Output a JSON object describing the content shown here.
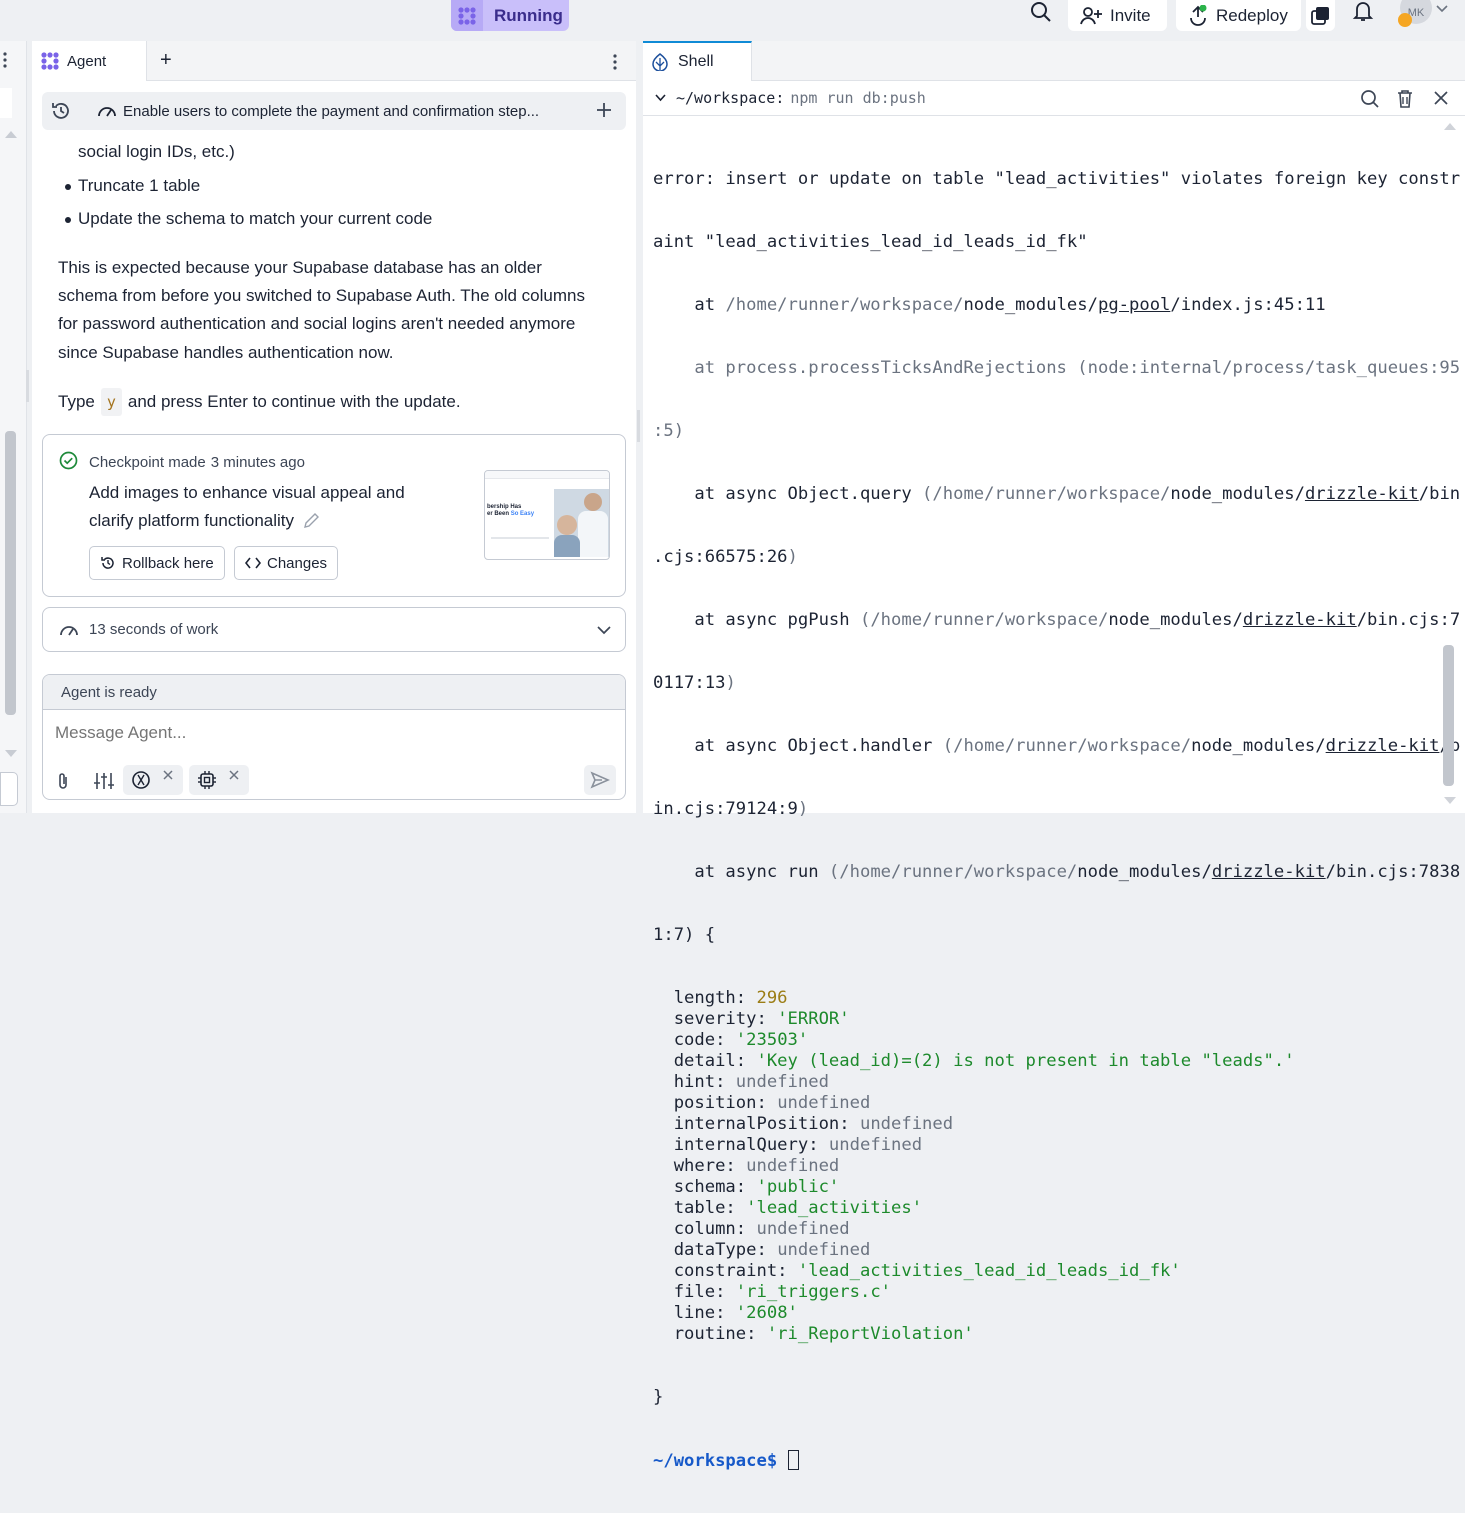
{
  "topbar": {
    "status_label": "Running",
    "invite_label": "Invite",
    "redeploy_label": "Redeploy",
    "avatar_initials": "MK"
  },
  "agent": {
    "tab_label": "Agent",
    "add_tab": "+",
    "task_title": "Enable users to complete the payment and confirmation step...",
    "body": {
      "line_partial": "social login IDs, etc.)",
      "bullets": [
        "Truncate 1 table",
        "Update the schema to match your current code"
      ],
      "paragraph_lines": [
        "This is expected because your Supabase database has an older",
        "schema from before you switched to Supabase Auth. The old columns",
        "for password authentication and social logins aren't needed anymore",
        "since Supabase handles authentication now."
      ],
      "type_prefix": "Type",
      "type_key": "y",
      "type_suffix": "and press Enter to continue with the update."
    },
    "checkpoint": {
      "made_label": "Checkpoint made",
      "time_ago": "3 minutes ago",
      "description_line1": "Add images to enhance visual appeal and",
      "description_line2": "clarify platform functionality",
      "rollback_label": "Rollback here",
      "changes_label": "Changes",
      "thumb_heading_1": "bership Has",
      "thumb_heading_2": "er Been",
      "thumb_heading_accent": "So Easy"
    },
    "work_summary": "13 seconds of work",
    "composer": {
      "status": "Agent is ready",
      "placeholder": "Message Agent..."
    }
  },
  "shell": {
    "tab_label": "Shell",
    "cwd": "~/workspace:",
    "command": "npm run db:push",
    "prompt": "~/workspace$",
    "output": {
      "l1": "error: insert or update on table \"lead_activities\" violates foreign key constr",
      "l2": "aint \"lead_activities_lead_id_leads_id_fk\"",
      "l3_at": "    at ",
      "l3_dim": "/home/runner/workspace/",
      "l3_a": "node_modules/",
      "l3_u": "pg-pool",
      "l3_b": "/index.js:45:11",
      "l4": "    at process.processTicksAndRejections (node:internal/process/task_queues:95",
      "l5": ":5)",
      "l6_a": "    at async Object.query ",
      "l6_dim": "(/home/runner/workspace/",
      "l6_b": "node_modules/",
      "l6_u": "drizzle-kit",
      "l6_c": "/bin",
      "l7": ".cjs:66575:26",
      "l7_dim": ")",
      "l8_a": "    at async pgPush ",
      "l8_dim": "(/home/runner/workspace/",
      "l8_b": "node_modules/",
      "l8_u": "drizzle-kit",
      "l8_c": "/bin.cjs:7",
      "l9": "0117:13",
      "l9_dim": ")",
      "l10_a": "    at async Object.handler ",
      "l10_dim": "(/home/runner/workspace/",
      "l10_b": "node_modules/",
      "l10_u": "drizzle-kit",
      "l10_c": "/b",
      "l11": "in.cjs:79124:9",
      "l11_dim": ")",
      "l12_a": "    at async run ",
      "l12_dim": "(/home/runner/workspace/",
      "l12_b": "node_modules/",
      "l12_u": "drizzle-kit",
      "l12_c": "/bin.cjs:7838",
      "l13": "1:7) {",
      "fields": [
        {
          "key": "  length: ",
          "val": "296",
          "cls": "t-num"
        },
        {
          "key": "  severity: ",
          "val": "'ERROR'",
          "cls": "t-str"
        },
        {
          "key": "  code: ",
          "val": "'23503'",
          "cls": "t-str"
        },
        {
          "key": "  detail: ",
          "val": "'Key (lead_id)=(2) is not present in table \"leads\".'",
          "cls": "t-str"
        },
        {
          "key": "  hint: ",
          "val": "undefined",
          "cls": "t-dim"
        },
        {
          "key": "  position: ",
          "val": "undefined",
          "cls": "t-dim"
        },
        {
          "key": "  internalPosition: ",
          "val": "undefined",
          "cls": "t-dim"
        },
        {
          "key": "  internalQuery: ",
          "val": "undefined",
          "cls": "t-dim"
        },
        {
          "key": "  where: ",
          "val": "undefined",
          "cls": "t-dim"
        },
        {
          "key": "  schema: ",
          "val": "'public'",
          "cls": "t-str"
        },
        {
          "key": "  table: ",
          "val": "'lead_activities'",
          "cls": "t-str"
        },
        {
          "key": "  column: ",
          "val": "undefined",
          "cls": "t-dim"
        },
        {
          "key": "  dataType: ",
          "val": "undefined",
          "cls": "t-dim"
        },
        {
          "key": "  constraint: ",
          "val": "'lead_activities_lead_id_leads_id_fk'",
          "cls": "t-str"
        },
        {
          "key": "  file: ",
          "val": "'ri_triggers.c'",
          "cls": "t-str"
        },
        {
          "key": "  line: ",
          "val": "'2608'",
          "cls": "t-str"
        },
        {
          "key": "  routine: ",
          "val": "'ri_ReportViolation'",
          "cls": "t-str"
        }
      ],
      "close": "}"
    }
  },
  "colors": {
    "accent": "#c9bffa",
    "shell_tab_accent": "#0f8bd6",
    "prompt": "#1659c9",
    "string": "#1d8a2c",
    "number": "#9b7d15"
  }
}
